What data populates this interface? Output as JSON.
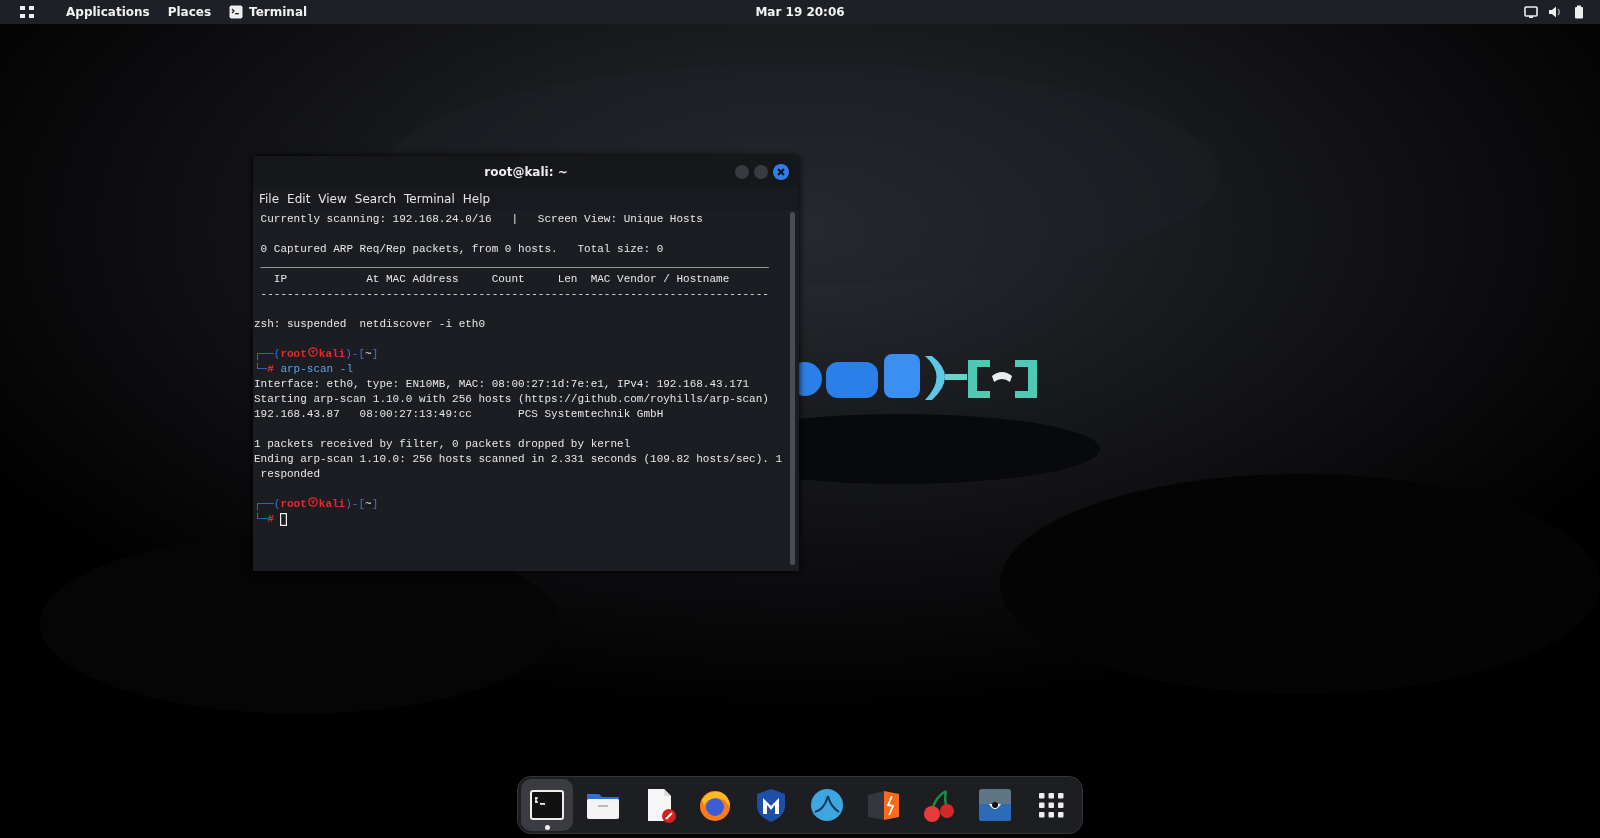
{
  "top_bar": {
    "menus": [
      {
        "label": "Applications"
      },
      {
        "label": "Places"
      }
    ],
    "app": {
      "label": "Terminal"
    },
    "clock": "Mar 19  20:06"
  },
  "terminal": {
    "title": "root@kali: ~",
    "menu": [
      "File",
      "Edit",
      "View",
      "Search",
      "Terminal",
      "Help"
    ],
    "lines": [
      {
        "kind": "out",
        "text": " Currently scanning: 192.168.24.0/16   |   Screen View: Unique Hosts"
      },
      {
        "kind": "blank"
      },
      {
        "kind": "out",
        "text": " 0 Captured ARP Req/Rep packets, from 0 hosts.   Total size: 0"
      },
      {
        "kind": "out",
        "text": " _____________________________________________________________________________"
      },
      {
        "kind": "out",
        "text": "   IP            At MAC Address     Count     Len  MAC Vendor / Hostname"
      },
      {
        "kind": "out",
        "text": " -----------------------------------------------------------------------------"
      },
      {
        "kind": "blank"
      },
      {
        "kind": "out",
        "text": "zsh: suspended  netdiscover -i eth0"
      },
      {
        "kind": "blank"
      },
      {
        "kind": "prompt_head",
        "open": "┌──(",
        "user": "root",
        "host": "kali",
        "close": ")-[",
        "dir": "~",
        "end": "]"
      },
      {
        "kind": "prompt_cmd",
        "corner": "└─",
        "hash": "#",
        "command": "arp-scan -l",
        "cursor": false
      },
      {
        "kind": "out",
        "text": "Interface: eth0, type: EN10MB, MAC: 08:00:27:1d:7e:e1, IPv4: 192.168.43.171"
      },
      {
        "kind": "out",
        "text": "Starting arp-scan 1.10.0 with 256 hosts (https://github.com/royhills/arp-scan)"
      },
      {
        "kind": "out",
        "text": "192.168.43.87   08:00:27:13:49:cc       PCS Systemtechnik GmbH"
      },
      {
        "kind": "blank"
      },
      {
        "kind": "out",
        "text": "1 packets received by filter, 0 packets dropped by kernel"
      },
      {
        "kind": "out",
        "text": "Ending arp-scan 1.10.0: 256 hosts scanned in 2.331 seconds (109.82 hosts/sec). 1"
      },
      {
        "kind": "out",
        "text": " responded"
      },
      {
        "kind": "blank"
      },
      {
        "kind": "prompt_head",
        "open": "┌──(",
        "user": "root",
        "host": "kali",
        "close": ")-[",
        "dir": "~",
        "end": "]"
      },
      {
        "kind": "prompt_cmd",
        "corner": "└─",
        "hash": "#",
        "cursor": true
      }
    ]
  },
  "dock": {
    "items": [
      {
        "kind": "terminal",
        "selected": true,
        "running": true
      },
      {
        "kind": "files",
        "selected": false,
        "running": false
      },
      {
        "kind": "editor",
        "selected": false,
        "running": false
      },
      {
        "kind": "browser",
        "selected": false,
        "running": false
      },
      {
        "kind": "shield",
        "selected": false,
        "running": false
      },
      {
        "kind": "shark",
        "selected": false,
        "running": false
      },
      {
        "kind": "bolt",
        "selected": false,
        "running": false
      },
      {
        "kind": "cherry",
        "selected": false,
        "running": false
      },
      {
        "kind": "eye",
        "selected": false,
        "running": false
      },
      {
        "kind": "grid",
        "selected": false,
        "running": false
      }
    ]
  }
}
